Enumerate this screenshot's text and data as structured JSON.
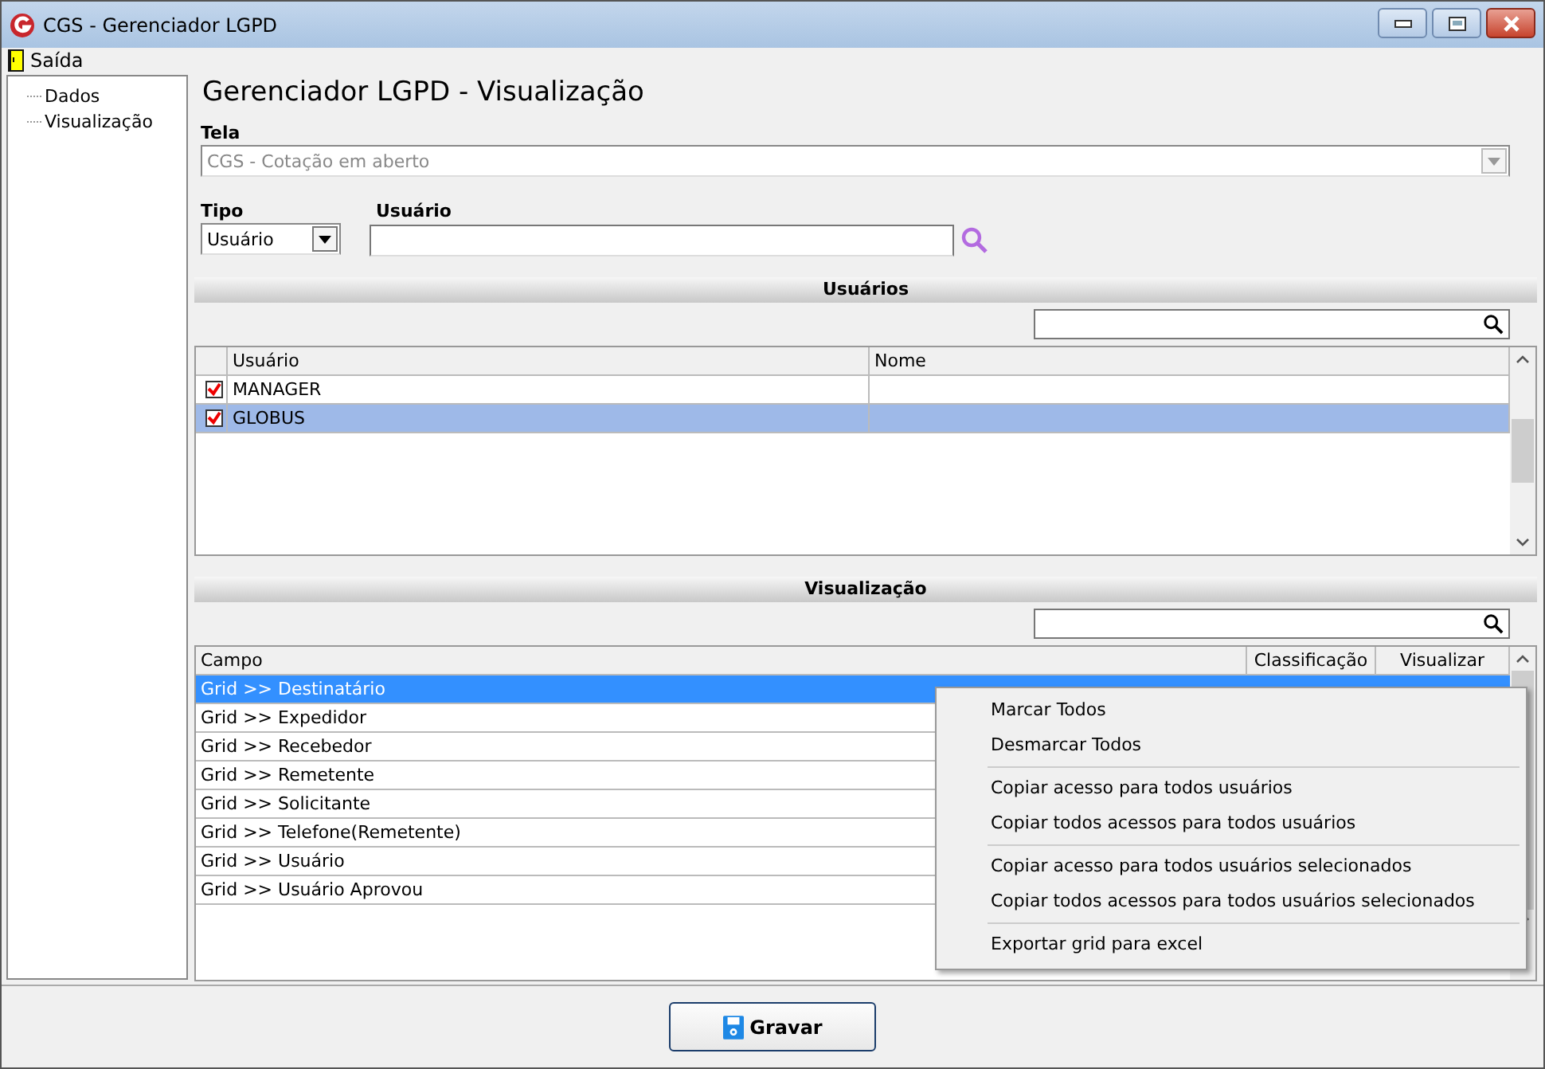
{
  "window": {
    "title": "CGS - Gerenciador LGPD"
  },
  "menu": [
    {
      "label": "Saída"
    }
  ],
  "sidebar": {
    "items": [
      {
        "label": "Dados"
      },
      {
        "label": "Visualização"
      }
    ]
  },
  "heading": "Gerenciador LGPD - Visualização",
  "tela": {
    "label": "Tela",
    "value": "CGS - Cotação em aberto",
    "disabled": true
  },
  "tipo": {
    "label": "Tipo",
    "value": "Usuário"
  },
  "usuario": {
    "label": "Usuário"
  },
  "users": {
    "title": "Usuários",
    "columns": [
      "Usuário",
      "Nome"
    ],
    "rows": [
      {
        "usuario": "MANAGER",
        "checked": true,
        "selected": false
      },
      {
        "usuario": "GLOBUS",
        "checked": true,
        "selected": true
      }
    ]
  },
  "fields": {
    "title": "Visualização",
    "columns": [
      "Campo",
      "Classificação",
      "Visualizar"
    ],
    "rows": [
      {
        "campo": "Grid >> Destinatário",
        "selected": true
      },
      {
        "campo": "Grid >> Expedidor",
        "selected": false
      },
      {
        "campo": "Grid >> Recebedor",
        "selected": false
      },
      {
        "campo": "Grid >> Remetente",
        "selected": false
      },
      {
        "campo": "Grid >> Solicitante",
        "selected": false
      },
      {
        "campo": "Grid >> Telefone(Remetente)",
        "selected": false
      },
      {
        "campo": "Grid >> Usuário",
        "selected": false
      },
      {
        "campo": "Grid >> Usuário Aprovou",
        "selected": false
      }
    ]
  },
  "context_menu": {
    "groups": [
      [
        "Marcar Todos",
        "Desmarcar Todos"
      ],
      [
        "Copiar acesso para todos usuários",
        "Copiar todos acessos para todos usuários"
      ],
      [
        "Copiar acesso para todos usuários selecionados",
        "Copiar todos acessos para todos usuários selecionados"
      ],
      [
        "Exportar grid para excel"
      ]
    ]
  },
  "save_button": {
    "label": "Gravar"
  }
}
